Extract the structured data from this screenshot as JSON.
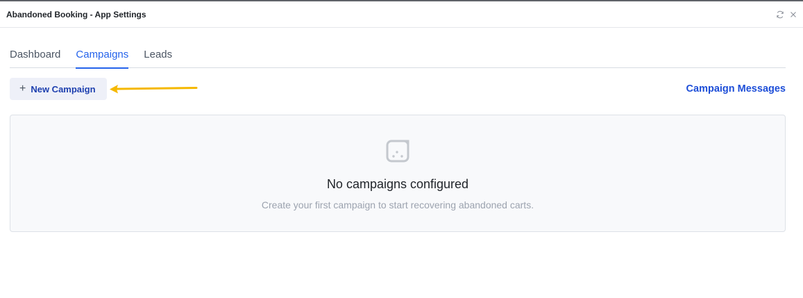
{
  "window": {
    "title": "Abandoned Booking - App Settings",
    "icons": [
      "refresh-icon",
      "close-icon"
    ]
  },
  "tabs": [
    {
      "label": "Dashboard",
      "active": false
    },
    {
      "label": "Campaigns",
      "active": true
    },
    {
      "label": "Leads",
      "active": false
    }
  ],
  "toolbar": {
    "new_campaign_label": "New Campaign",
    "new_campaign_icon": "plus-icon",
    "campaign_messages_label": "Campaign Messages"
  },
  "empty_state": {
    "icon": "empty-box-icon",
    "title": "No campaigns configured",
    "subtitle": "Create your first campaign to start recovering abandoned carts."
  },
  "colors": {
    "accent": "#2563eb",
    "annotation_arrow": "#f5b800"
  }
}
